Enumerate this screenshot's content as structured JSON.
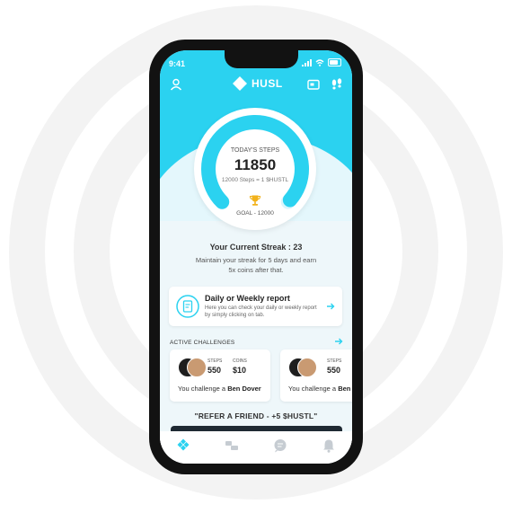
{
  "status_bar": {
    "time": "9:41"
  },
  "header": {
    "app_name": "HUSL"
  },
  "steps": {
    "label": "TODAY'S STEPS",
    "value": "11850",
    "conversion": "12000 Steps = 1 $HUSTL",
    "goal": "GOAL - 12000",
    "progress_fraction": 0.9875
  },
  "streak": {
    "title": "Your Current Streak : 23",
    "description": "Maintain your streak for 5 days and earn 5x coins after that."
  },
  "report_card": {
    "title": "Daily or Weekly report",
    "description": "Here you can check your daily or weekly report by simply clicking on tab."
  },
  "active_challenges": {
    "title": "ACTIVE CHALLENGES",
    "cards": [
      {
        "steps_label": "STEPS",
        "steps_value": "550",
        "coins_label": "COINS",
        "coins_value": "$10",
        "text": "You challenge a",
        "opponent": "Ben Dover"
      },
      {
        "steps_label": "STEPS",
        "steps_value": "550",
        "text": "You challenge a",
        "opponent": "Ben Dover"
      }
    ]
  },
  "refer": {
    "text": "\"REFER A FRIEND - +5 $HUSTL\""
  },
  "colors": {
    "accent": "#2bd2f0",
    "phone_frame": "#121212"
  },
  "icons": [
    "profile-icon",
    "husl-logo-icon",
    "wallet-icon",
    "footsteps-icon",
    "trophy-icon",
    "report-icon",
    "arrow-right-icon",
    "home-tab-icon",
    "challenges-tab-icon",
    "chat-tab-icon",
    "bell-tab-icon"
  ]
}
